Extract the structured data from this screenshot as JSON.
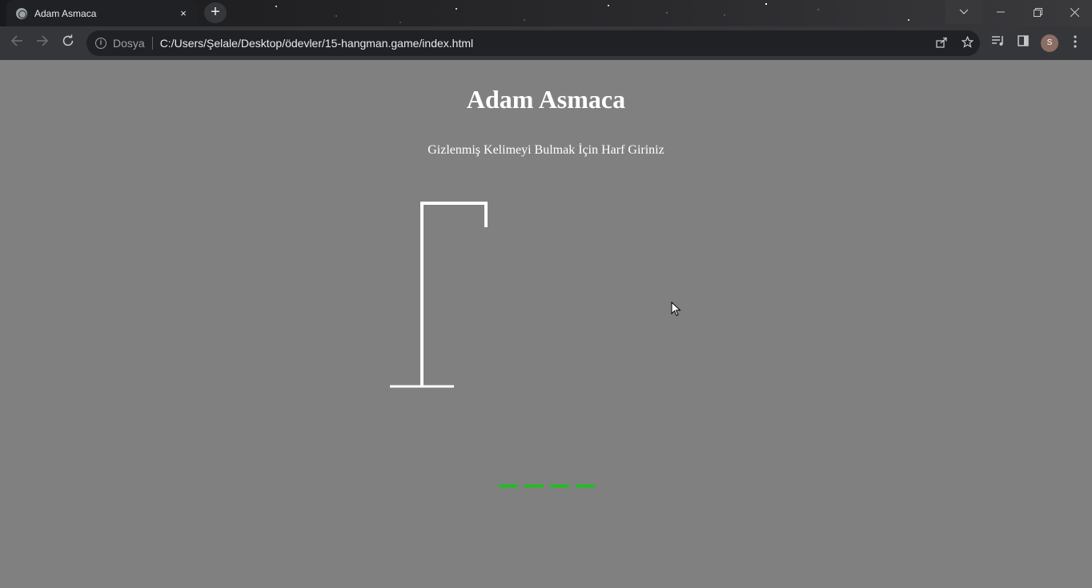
{
  "browser": {
    "tab_title": "Adam Asmaca",
    "tab_close": "×",
    "new_tab": "+",
    "address_scheme_label": "Dosya",
    "address_url": "C:/Users/Şelale/Desktop/ödevler/15-hangman.game/index.html",
    "profile_initial": "S",
    "icons": [
      "globe-icon",
      "back-arrow-icon",
      "forward-arrow-icon",
      "reload-icon",
      "info-icon",
      "share-icon",
      "star-icon",
      "reading-list-icon",
      "side-panel-icon",
      "menu-icon"
    ]
  },
  "game": {
    "title": "Adam Asmaca",
    "instruction": "Gizlenmiş Kelimeyi Bulmak İçin Harf Giriniz",
    "word_slots": [
      "",
      "",
      "",
      ""
    ],
    "colors": {
      "background": "#808080",
      "gallows": "#ffffff",
      "word_underline": "#00d000"
    }
  }
}
